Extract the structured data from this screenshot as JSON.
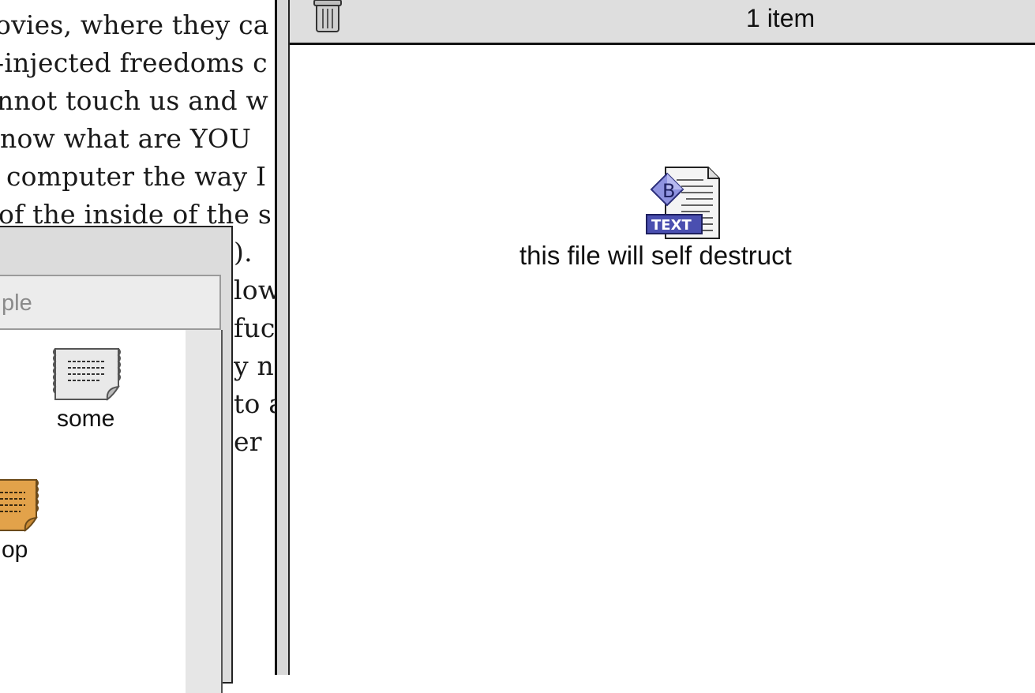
{
  "document": {
    "lines": [
      "ovies, where they ca",
      "-injected freedoms c",
      "nnot touch us and w",
      "now what are YOU",
      "computer the way I",
      "of the inside of the s",
      ").",
      "low",
      "fuc",
      "y n",
      "to a",
      "er"
    ]
  },
  "left_window": {
    "header_text": "ple",
    "items": [
      {
        "label": "some",
        "icon": "text-clipping-icon"
      },
      {
        "label": "op",
        "icon": "text-clipping-orange-icon"
      }
    ]
  },
  "main_window": {
    "header_status": "1 item",
    "trash_icon": "trash-icon",
    "file": {
      "label": "this file will self destruct",
      "icon": "bbedit-text-document-icon",
      "badge": "TEXT"
    }
  },
  "colors": {
    "window_chrome": "#dcdcdc",
    "document_icon_accent": "#4a4fb0",
    "clipping_orange": "#e2a24a"
  }
}
